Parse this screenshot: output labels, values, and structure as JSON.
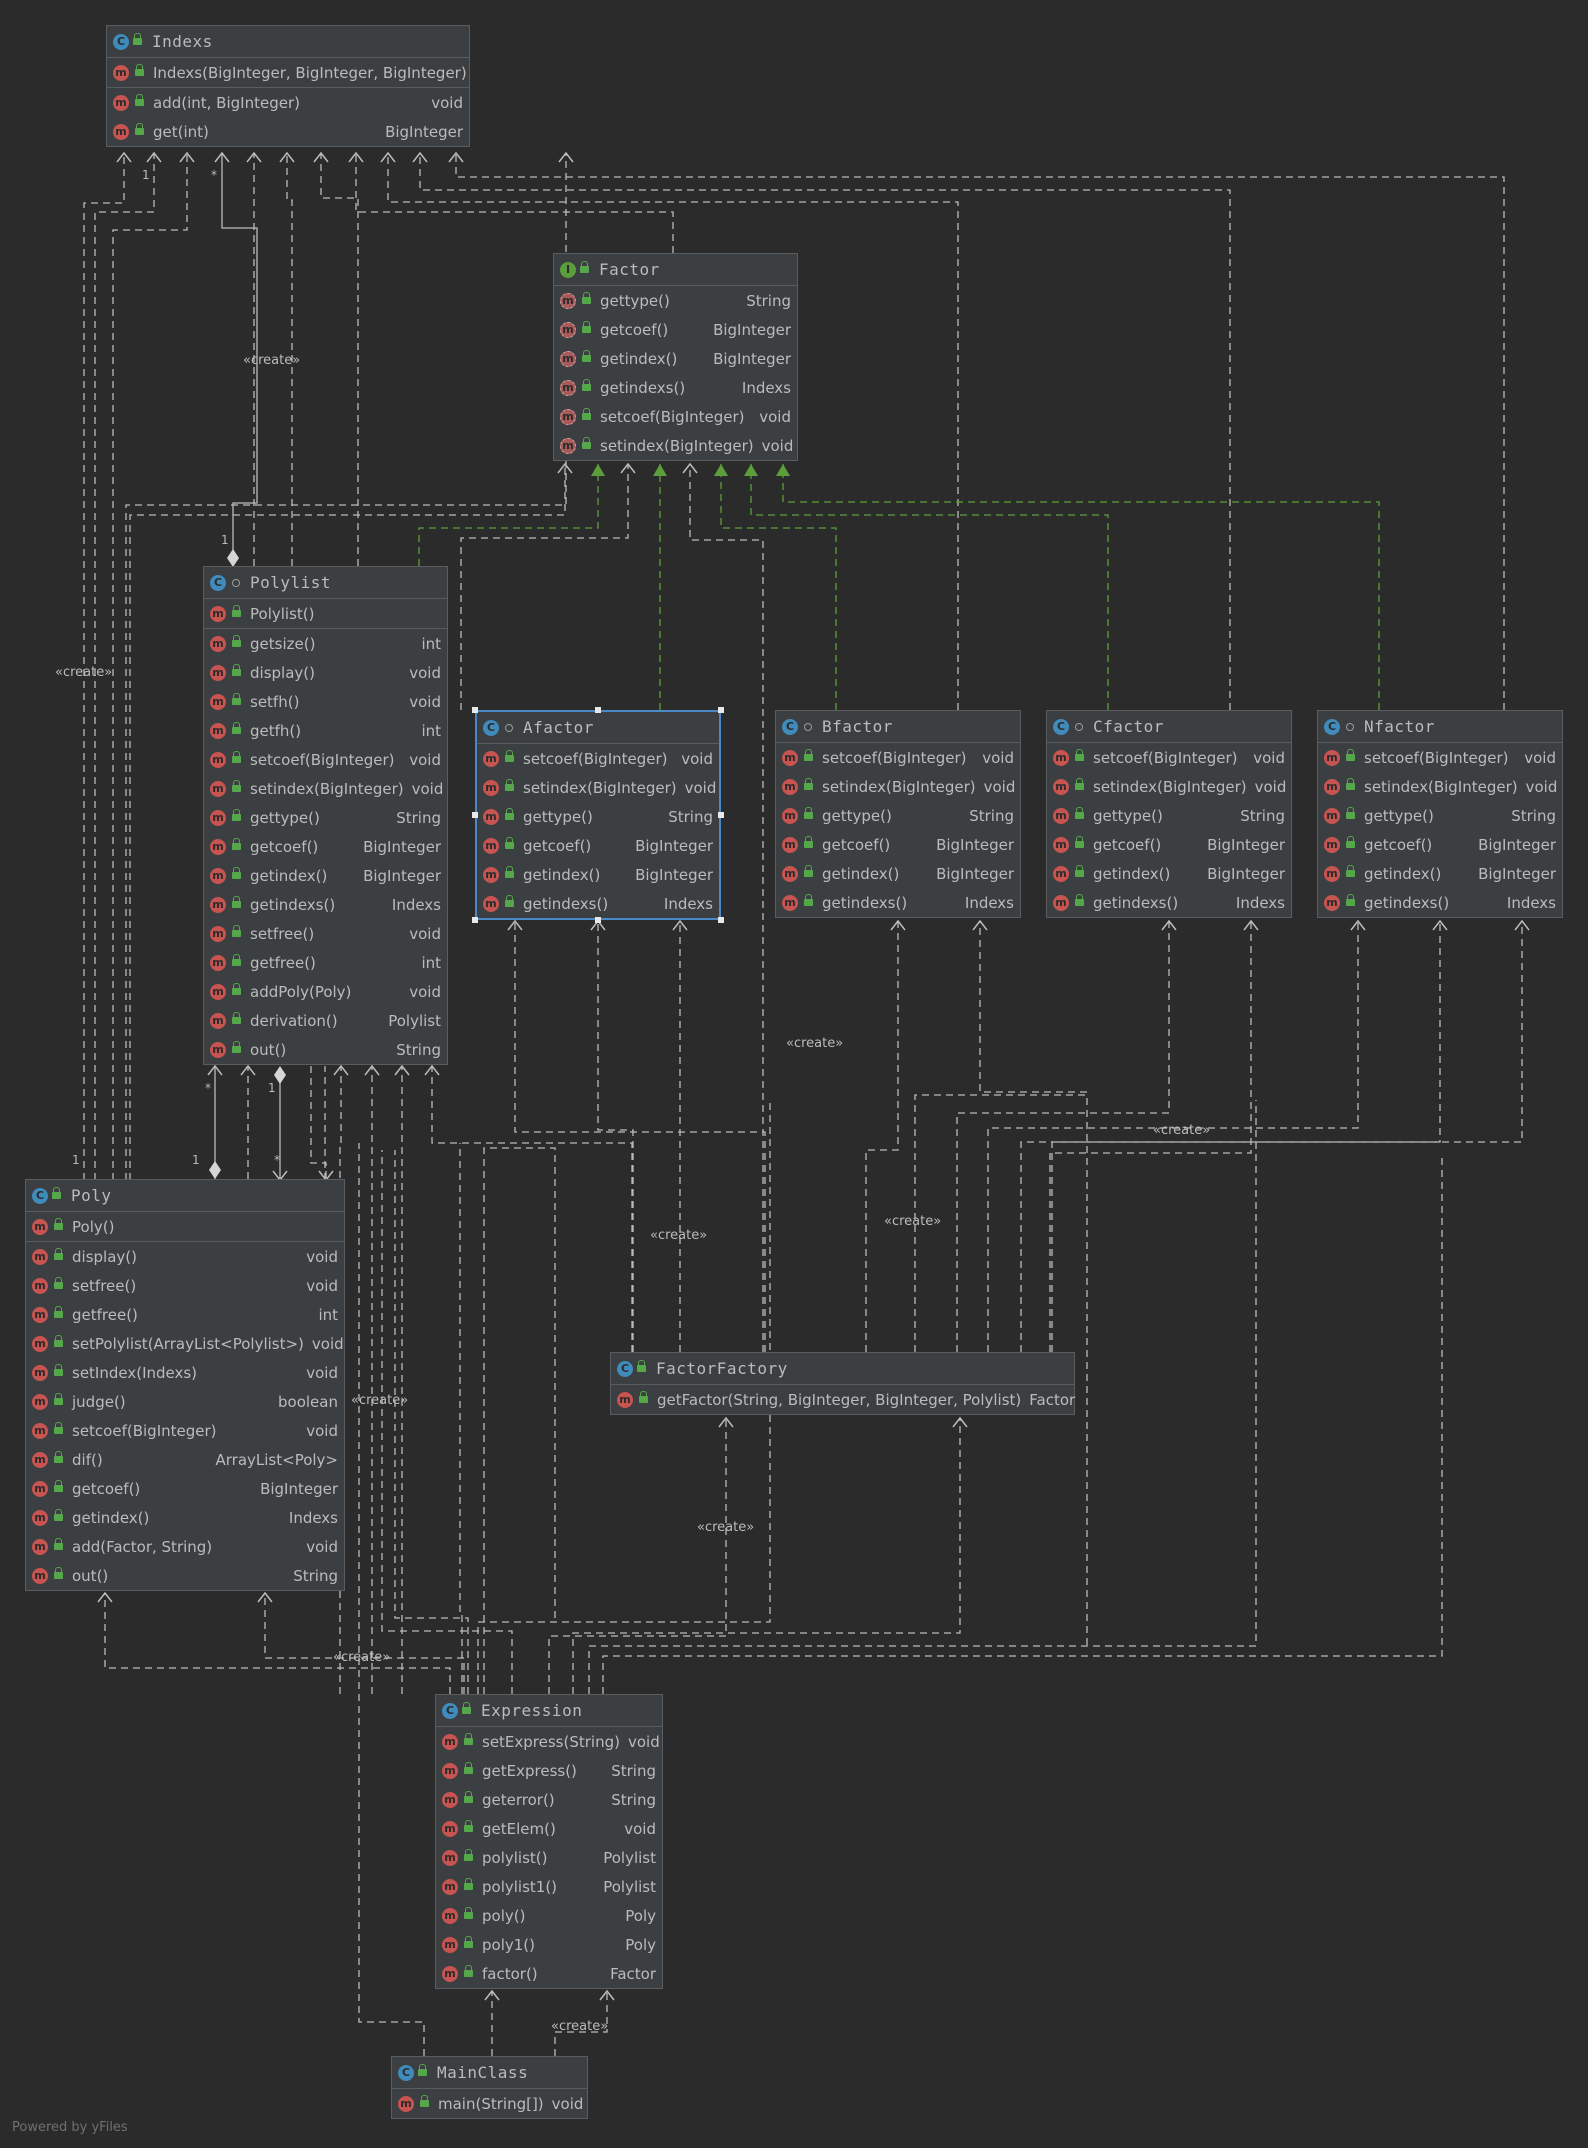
{
  "nodes": [
    {
      "key": "Indexs",
      "kind": "C",
      "title": "Indexs",
      "vis": "lock",
      "ctors": [
        {
          "name": "Indexs(BigInteger, BigInteger, BigInteger)",
          "type": ""
        }
      ],
      "methods": [
        {
          "name": "add(int, BigInteger)",
          "type": "void"
        },
        {
          "name": "get(int)",
          "type": "BigInteger"
        }
      ]
    },
    {
      "key": "Factor",
      "kind": "I",
      "title": "Factor",
      "vis": "lock",
      "ctors": [],
      "methods": [
        {
          "name": "gettype()",
          "type": "String"
        },
        {
          "name": "getcoef()",
          "type": "BigInteger"
        },
        {
          "name": "getindex()",
          "type": "BigInteger"
        },
        {
          "name": "getindexs()",
          "type": "Indexs"
        },
        {
          "name": "setcoef(BigInteger)",
          "type": "void"
        },
        {
          "name": "setindex(BigInteger)",
          "type": "void"
        }
      ]
    },
    {
      "key": "Polylist",
      "kind": "C",
      "title": "Polylist",
      "vis": "pkg",
      "ctors": [
        {
          "name": "Polylist()",
          "type": ""
        }
      ],
      "methods": [
        {
          "name": "getsize()",
          "type": "int"
        },
        {
          "name": "display()",
          "type": "void"
        },
        {
          "name": "setfh()",
          "type": "void"
        },
        {
          "name": "getfh()",
          "type": "int"
        },
        {
          "name": "setcoef(BigInteger)",
          "type": "void"
        },
        {
          "name": "setindex(BigInteger)",
          "type": "void"
        },
        {
          "name": "gettype()",
          "type": "String"
        },
        {
          "name": "getcoef()",
          "type": "BigInteger"
        },
        {
          "name": "getindex()",
          "type": "BigInteger"
        },
        {
          "name": "getindexs()",
          "type": "Indexs"
        },
        {
          "name": "setfree()",
          "type": "void"
        },
        {
          "name": "getfree()",
          "type": "int"
        },
        {
          "name": "addPoly(Poly)",
          "type": "void"
        },
        {
          "name": "derivation()",
          "type": "Polylist"
        },
        {
          "name": "out()",
          "type": "String"
        }
      ]
    },
    {
      "key": "Afactor",
      "kind": "C",
      "title": "Afactor",
      "vis": "pkg",
      "ctors": [],
      "methods": [
        {
          "name": "setcoef(BigInteger)",
          "type": "void"
        },
        {
          "name": "setindex(BigInteger)",
          "type": "void"
        },
        {
          "name": "gettype()",
          "type": "String"
        },
        {
          "name": "getcoef()",
          "type": "BigInteger"
        },
        {
          "name": "getindex()",
          "type": "BigInteger"
        },
        {
          "name": "getindexs()",
          "type": "Indexs"
        }
      ]
    },
    {
      "key": "Bfactor",
      "kind": "C",
      "title": "Bfactor",
      "vis": "pkg",
      "ctors": [],
      "methods": [
        {
          "name": "setcoef(BigInteger)",
          "type": "void"
        },
        {
          "name": "setindex(BigInteger)",
          "type": "void"
        },
        {
          "name": "gettype()",
          "type": "String"
        },
        {
          "name": "getcoef()",
          "type": "BigInteger"
        },
        {
          "name": "getindex()",
          "type": "BigInteger"
        },
        {
          "name": "getindexs()",
          "type": "Indexs"
        }
      ]
    },
    {
      "key": "Cfactor",
      "kind": "C",
      "title": "Cfactor",
      "vis": "pkg",
      "ctors": [],
      "methods": [
        {
          "name": "setcoef(BigInteger)",
          "type": "void"
        },
        {
          "name": "setindex(BigInteger)",
          "type": "void"
        },
        {
          "name": "gettype()",
          "type": "String"
        },
        {
          "name": "getcoef()",
          "type": "BigInteger"
        },
        {
          "name": "getindex()",
          "type": "BigInteger"
        },
        {
          "name": "getindexs()",
          "type": "Indexs"
        }
      ]
    },
    {
      "key": "Nfactor",
      "kind": "C",
      "title": "Nfactor",
      "vis": "pkg",
      "ctors": [],
      "methods": [
        {
          "name": "setcoef(BigInteger)",
          "type": "void"
        },
        {
          "name": "setindex(BigInteger)",
          "type": "void"
        },
        {
          "name": "gettype()",
          "type": "String"
        },
        {
          "name": "getcoef()",
          "type": "BigInteger"
        },
        {
          "name": "getindex()",
          "type": "BigInteger"
        },
        {
          "name": "getindexs()",
          "type": "Indexs"
        }
      ]
    },
    {
      "key": "Poly",
      "kind": "C",
      "title": "Poly",
      "vis": "lock",
      "ctors": [
        {
          "name": "Poly()",
          "type": ""
        }
      ],
      "methods": [
        {
          "name": "display()",
          "type": "void"
        },
        {
          "name": "setfree()",
          "type": "void"
        },
        {
          "name": "getfree()",
          "type": "int"
        },
        {
          "name": "setPolylist(ArrayList<Polylist>)",
          "type": "void"
        },
        {
          "name": "setIndex(Indexs)",
          "type": "void"
        },
        {
          "name": "judge()",
          "type": "boolean"
        },
        {
          "name": "setcoef(BigInteger)",
          "type": "void"
        },
        {
          "name": "dif()",
          "type": "ArrayList<Poly>"
        },
        {
          "name": "getcoef()",
          "type": "BigInteger"
        },
        {
          "name": "getindex()",
          "type": "Indexs"
        },
        {
          "name": "add(Factor, String)",
          "type": "void"
        },
        {
          "name": "out()",
          "type": "String"
        }
      ]
    },
    {
      "key": "FactorFactory",
      "kind": "C",
      "title": "FactorFactory",
      "vis": "lock",
      "ctors": [],
      "methods": [
        {
          "name": "getFactor(String, BigInteger, BigInteger, Polylist)",
          "type": "Factor"
        }
      ]
    },
    {
      "key": "Expression",
      "kind": "C",
      "title": "Expression",
      "vis": "lock",
      "ctors": [],
      "methods": [
        {
          "name": "setExpress(String)",
          "type": "void"
        },
        {
          "name": "getExpress()",
          "type": "String"
        },
        {
          "name": "geterror()",
          "type": "String"
        },
        {
          "name": "getElem()",
          "type": "void"
        },
        {
          "name": "polylist()",
          "type": "Polylist"
        },
        {
          "name": "polylist1()",
          "type": "Polylist"
        },
        {
          "name": "poly()",
          "type": "Poly"
        },
        {
          "name": "poly1()",
          "type": "Poly"
        },
        {
          "name": "factor()",
          "type": "Factor"
        }
      ]
    },
    {
      "key": "MainClass",
      "kind": "C",
      "title": "MainClass",
      "vis": "lock",
      "ctors": [],
      "methods": [
        {
          "name": "main(String[])",
          "type": "void"
        }
      ]
    }
  ],
  "edge_labels": [
    "«create»",
    "«create»",
    "«create»",
    "«create»",
    "«create»",
    "«create»",
    "«create»",
    "«create»",
    "«create»",
    "«create»"
  ],
  "multiplicities": [
    "1",
    "*",
    "1",
    "*",
    "1",
    "1",
    "*",
    "1"
  ],
  "colors": {
    "background": "#2b2b2b",
    "node": "#3c3f41",
    "edge": "#bbbbbb",
    "implements": "#5c9e3c",
    "selection": "#4a88c7"
  },
  "footer": "Powered by yFiles"
}
